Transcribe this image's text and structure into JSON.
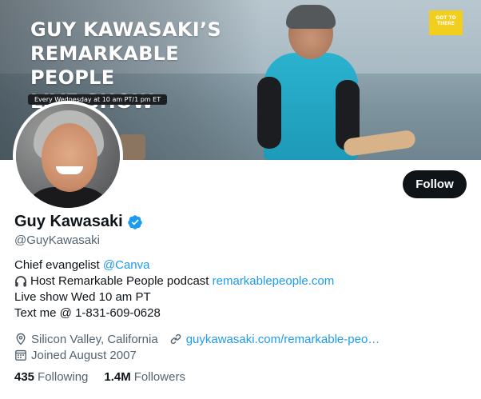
{
  "banner": {
    "title_lines": [
      "GUY KAWASAKI’S",
      "REMARKABLE PEOPLE",
      "LIVE SHOW"
    ],
    "schedule_pill": "Every Wednesday at 10 am PT/1 pm ET",
    "badge_text": "GOT TO THERE"
  },
  "profile": {
    "display_name": "Guy Kawasaki",
    "handle": "@GuyKawasaki",
    "follow_label": "Follow",
    "verified_icon": "verified-badge-icon"
  },
  "bio": {
    "line1_text": "Chief evangelist ",
    "line1_link": "@Canva",
    "line2_icon": "headphones-icon",
    "line2_text": "Host Remarkable People podcast ",
    "line2_link": "remarkablepeople.com",
    "line3_text": "Live show Wed 10 am PT",
    "line4_text": "Text me @ 1-831-609-0628"
  },
  "meta": {
    "location": "Silicon Valley, California",
    "website": "guykawasaki.com/remarkable-peo…",
    "joined": "Joined August 2007"
  },
  "stats": {
    "following_count": "435",
    "following_label": "Following",
    "followers_count": "1.4M",
    "followers_label": "Followers"
  },
  "colors": {
    "link": "#1d9bf0",
    "secondary_text": "#536471",
    "primary_text": "#0f1419",
    "follow_button": "#0f1419"
  }
}
